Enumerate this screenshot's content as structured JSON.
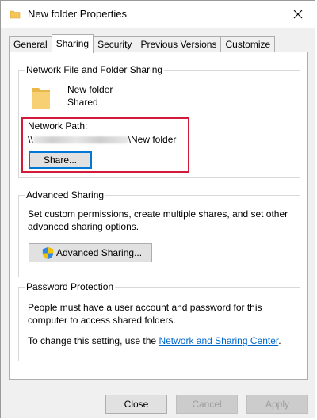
{
  "window": {
    "title": "New folder Properties"
  },
  "tabs": [
    "General",
    "Sharing",
    "Security",
    "Previous Versions",
    "Customize"
  ],
  "active_tab": "Sharing",
  "network_sharing": {
    "group_title": "Network File and Folder Sharing",
    "folder_name": "New folder",
    "status": "Shared",
    "path_label": "Network Path:",
    "path_prefix": "\\\\",
    "path_suffix": "\\New folder",
    "share_button": "Share..."
  },
  "advanced_sharing": {
    "group_title": "Advanced Sharing",
    "description": "Set custom permissions, create multiple shares, and set other advanced sharing options.",
    "button": "Advanced Sharing..."
  },
  "password_protection": {
    "group_title": "Password Protection",
    "description": "People must have a user account and password for this computer to access shared folders.",
    "change_text": "To change this setting, use the ",
    "link_text": "Network and Sharing Center",
    "change_suffix": "."
  },
  "footer": {
    "close": "Close",
    "cancel": "Cancel",
    "apply": "Apply"
  },
  "colors": {
    "highlight": "#d41a3a",
    "link": "#0066cc",
    "focus": "#0078d7",
    "folder": "#f3c55a"
  },
  "icons": [
    "folder-icon",
    "close-icon",
    "shield-icon"
  ]
}
